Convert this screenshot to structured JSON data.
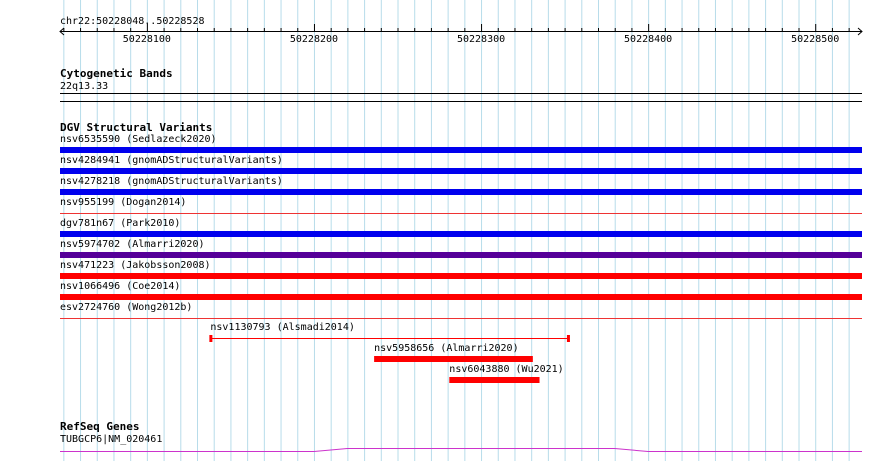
{
  "ruler": {
    "region": "chr22:50228048..50228528",
    "start": 50228048,
    "end": 50228528,
    "ticks": [
      "50228100",
      "50228200",
      "50228300",
      "50228400",
      "50228500"
    ]
  },
  "cytoband": {
    "title": "Cytogenetic Bands",
    "band": "22q13.33"
  },
  "dgv": {
    "title": "DGV Structural Variants",
    "colors": {
      "blue": "#0000ee",
      "red": "#ff0000",
      "purple": "#550099",
      "thin_red": "#ee3333"
    },
    "variants": [
      {
        "label": "nsv6535590 (Sedlazeck2020)",
        "color": "blue",
        "thick": true
      },
      {
        "label": "nsv4284941 (gnomADStructuralVariants)",
        "color": "blue",
        "thick": true
      },
      {
        "label": "nsv4278218 (gnomADStructuralVariants)",
        "color": "blue",
        "thick": true
      },
      {
        "label": "nsv955199 (Dogan2014)",
        "color": "thin_red",
        "thick": false
      },
      {
        "label": "dgv781n67 (Park2010)",
        "color": "blue",
        "thick": true
      },
      {
        "label": "nsv5974702 (Almarri2020)",
        "color": "purple",
        "thick": true
      },
      {
        "label": "nsv471223 (Jakobsson2008)",
        "color": "red",
        "thick": true
      },
      {
        "label": "nsv1066496 (Coe2014)",
        "color": "red",
        "thick": true
      },
      {
        "label": "esv2724760 (Wong2012b)",
        "color": "thin_red",
        "thick": false
      }
    ],
    "partial": [
      {
        "label": "nsv1130793 (Alsmadi2014)",
        "start": 50228138,
        "end": 50228352,
        "style": "whisker"
      },
      {
        "label": "nsv5958656 (Almarri2020)",
        "start": 50228236,
        "end": 50228331,
        "style": "thick"
      },
      {
        "label": "nsv6043880 (Wu2021)",
        "start": 50228281,
        "end": 50228335,
        "style": "thick"
      }
    ]
  },
  "refseq": {
    "title": "RefSeq Genes",
    "gene": "TUBGCP6|NM_020461",
    "color": "#cc33cc"
  }
}
